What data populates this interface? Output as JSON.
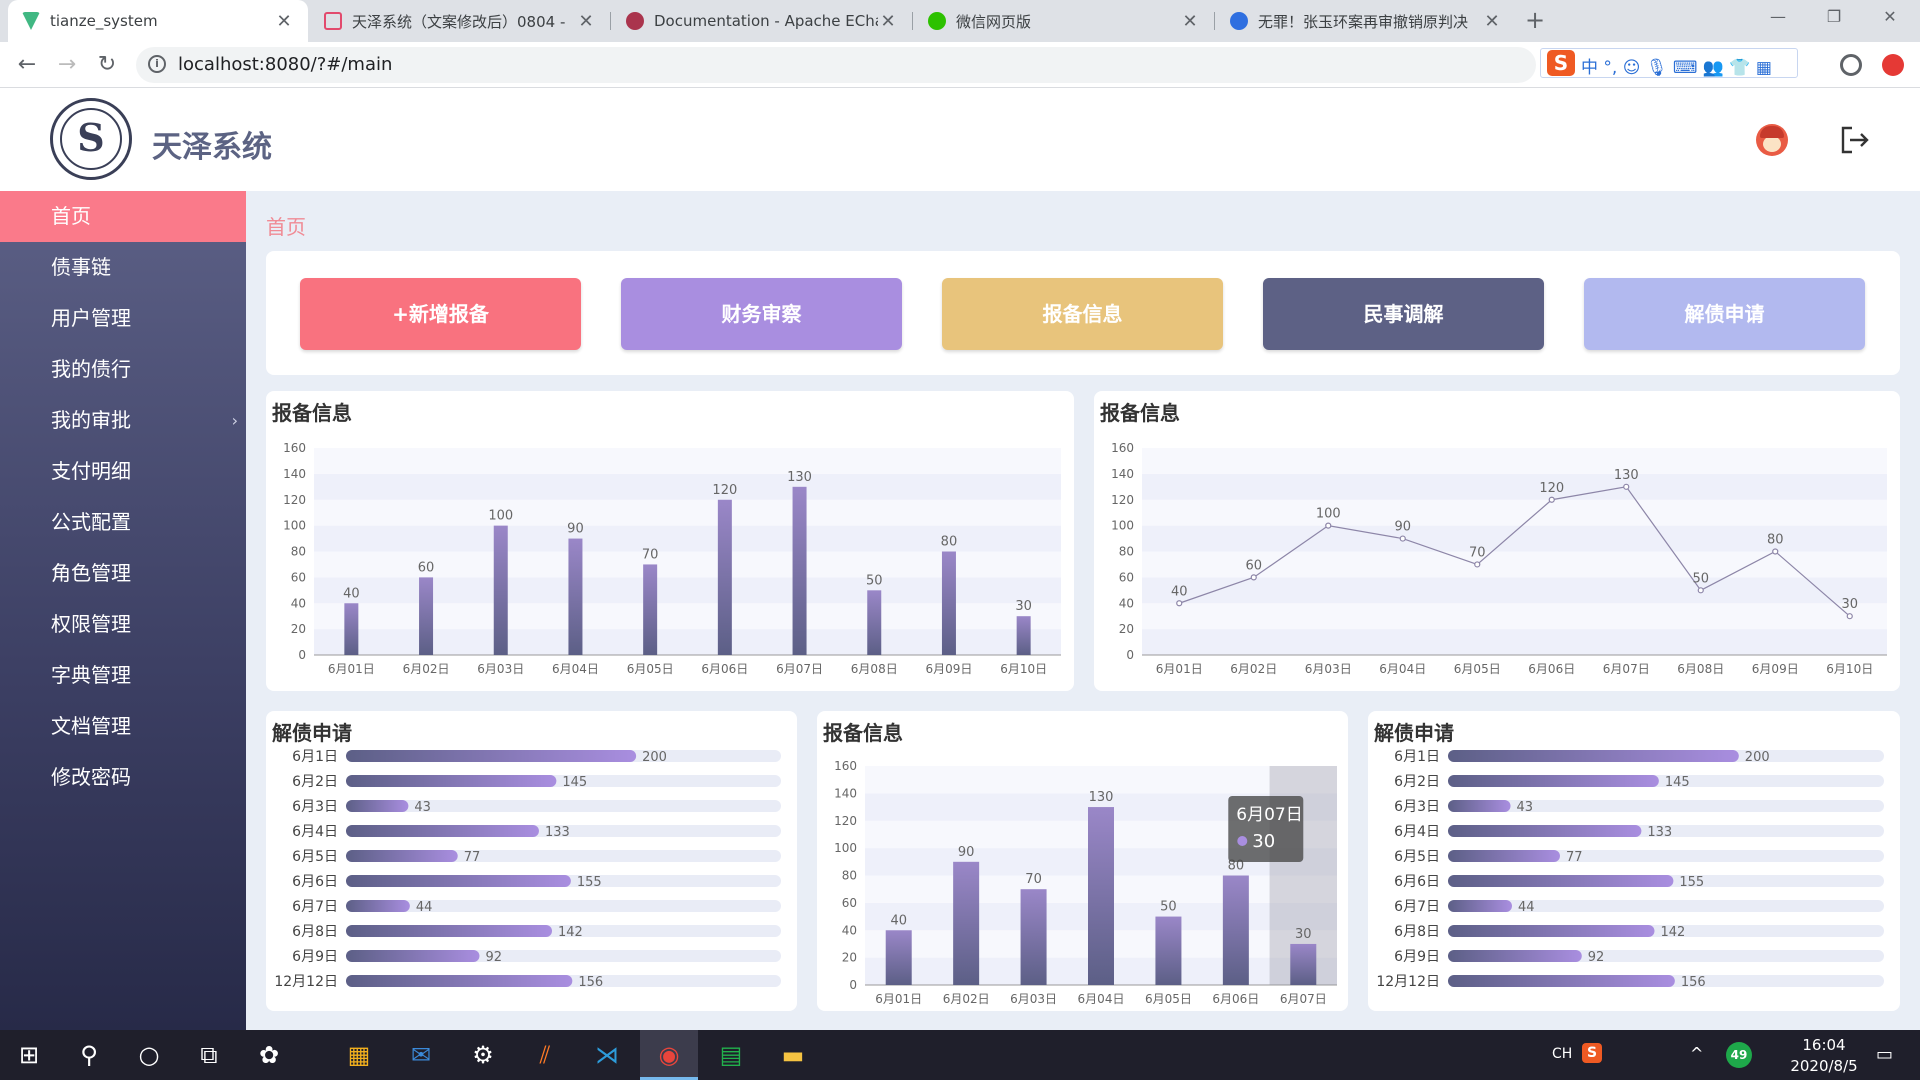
{
  "browser": {
    "tabs": [
      {
        "title": "tianze_system",
        "favicon_color": "#41b883",
        "active": true
      },
      {
        "title": "天泽系统（文案修改后）0804 -",
        "favicon_color": "#e24a6d",
        "active": false
      },
      {
        "title": "Documentation - Apache ECha",
        "favicon_color": "#aa344d",
        "active": false
      },
      {
        "title": "微信网页版",
        "favicon_color": "#2dc100",
        "active": false
      },
      {
        "title": "无罪！张玉环案再审撤销原判决",
        "favicon_color": "#2f6fe0",
        "active": false
      }
    ],
    "new_tab": "+",
    "minimize": "—",
    "maximize": "❐",
    "close": "✕",
    "back": "←",
    "forward": "→",
    "reload": "↻",
    "url": "localhost:8080/?#/main",
    "ime_logo": "S",
    "ime_text": "中 °, ☺ 🎙 ⌨ 👥 👕 ▦"
  },
  "app": {
    "name": "天泽系统",
    "logo_letter": "S",
    "logout_icon": "logout-icon"
  },
  "sidebar": {
    "items": [
      {
        "label": "首页",
        "active": true
      },
      {
        "label": "债事链"
      },
      {
        "label": "用户管理"
      },
      {
        "label": "我的债行"
      },
      {
        "label": "我的审批",
        "has_arrow": true
      },
      {
        "label": "支付明细"
      },
      {
        "label": "公式配置"
      },
      {
        "label": "角色管理"
      },
      {
        "label": "权限管理"
      },
      {
        "label": "字典管理"
      },
      {
        "label": "文档管理"
      },
      {
        "label": "修改密码"
      }
    ],
    "arrow": "›"
  },
  "breadcrumb": "首页",
  "quick_actions": [
    {
      "label": "+新增报备",
      "color": "#f9727f"
    },
    {
      "label": "财务审察",
      "color": "#a98ee0"
    },
    {
      "label": "报备信息",
      "color": "#e8c47c"
    },
    {
      "label": "民事调解",
      "color": "#5d6185"
    },
    {
      "label": "解债申请",
      "color": "#b2b9ef"
    }
  ],
  "cards": {
    "top_left_title": "报备信息",
    "top_right_title": "报备信息",
    "bottom_left_title": "解债申请",
    "bottom_mid_title": "报备信息",
    "bottom_right_title": "解债申请"
  },
  "chart_data": [
    {
      "type": "bar",
      "title": "报备信息",
      "categories": [
        "6月01日",
        "6月02日",
        "6月03日",
        "6月04日",
        "6月05日",
        "6月06日",
        "6月07日",
        "6月08日",
        "6月09日",
        "6月10日"
      ],
      "values": [
        40,
        60,
        100,
        90,
        70,
        120,
        130,
        50,
        80,
        30
      ],
      "yticks": [
        0,
        20,
        40,
        60,
        80,
        100,
        120,
        140,
        160
      ],
      "ylim": [
        0,
        160
      ]
    },
    {
      "type": "line",
      "title": "报备信息",
      "categories": [
        "6月01日",
        "6月02日",
        "6月03日",
        "6月04日",
        "6月05日",
        "6月06日",
        "6月07日",
        "6月08日",
        "6月09日",
        "6月10日"
      ],
      "values": [
        40,
        60,
        100,
        90,
        70,
        120,
        130,
        50,
        80,
        30
      ],
      "yticks": [
        0,
        20,
        40,
        60,
        80,
        100,
        120,
        140,
        160
      ],
      "ylim": [
        0,
        160
      ]
    },
    {
      "type": "bar",
      "orientation": "horizontal",
      "title": "解债申请",
      "categories": [
        "6月1日",
        "6月2日",
        "6月3日",
        "6月4日",
        "6月5日",
        "6月6日",
        "6月7日",
        "6月8日",
        "6月9日",
        "12月12日"
      ],
      "values": [
        200,
        145,
        43,
        133,
        77,
        155,
        44,
        142,
        92,
        156
      ],
      "xlim": [
        0,
        200
      ]
    },
    {
      "type": "bar",
      "title": "报备信息",
      "categories": [
        "6月01日",
        "6月02日",
        "6月03日",
        "6月04日",
        "6月05日",
        "6月06日",
        "6月07日"
      ],
      "values": [
        40,
        90,
        70,
        130,
        50,
        80,
        30
      ],
      "yticks": [
        0,
        20,
        40,
        60,
        80,
        100,
        120,
        140,
        160
      ],
      "ylim": [
        0,
        160
      ],
      "tooltip": {
        "category": "6月07日",
        "value": "30"
      }
    },
    {
      "type": "bar",
      "orientation": "horizontal",
      "title": "解债申请",
      "categories": [
        "6月1日",
        "6月2日",
        "6月3日",
        "6月4日",
        "6月5日",
        "6月6日",
        "6月7日",
        "6月8日",
        "6月9日",
        "12月12日"
      ],
      "values": [
        200,
        145,
        43,
        133,
        77,
        155,
        44,
        142,
        92,
        156
      ],
      "xlim": [
        0,
        200
      ]
    }
  ],
  "taskbar": {
    "items": [
      "start-icon",
      "search-icon",
      "cortana-icon",
      "task-view-icon",
      "app-icon",
      "store-icon",
      "mail-icon",
      "settings-icon",
      "sublime-icon",
      "vscode-icon",
      "chrome-icon",
      "notepad-icon",
      "explorer-icon"
    ],
    "lang": "CH",
    "ime_logo": "S",
    "up_arrow": "^",
    "badge": "49",
    "time": "16:04",
    "date": "2020/8/5"
  }
}
